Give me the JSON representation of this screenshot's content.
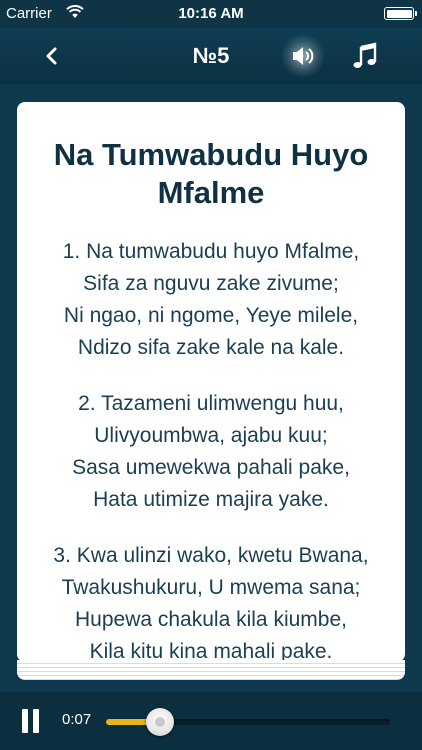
{
  "status": {
    "carrier": "Carrier",
    "time": "10:16 AM",
    "battery_level": 1.0
  },
  "nav": {
    "title": "№5",
    "back_icon": "chevron-left-icon",
    "speaker_icon": "speaker-icon",
    "music_icon": "music-note-icon"
  },
  "hymn": {
    "title": "Na Tumwabudu Huyo Mfalme",
    "verses": [
      [
        "1. Na tumwabudu huyo Mfalme,",
        "Sifa za nguvu zake zivume;",
        "Ni ngao, ni ngome, Yeye milele,",
        "Ndizo sifa zake kale na kale."
      ],
      [
        "2. Tazameni ulimwengu huu,",
        "Ulivyoumbwa, ajabu kuu;",
        "Sasa umewekwa pahali pake,",
        "Hata utimize majira yake."
      ],
      [
        "3. Kwa ulinzi wako, kwetu Bwana,",
        "Twakushukuru, U mwema sana;",
        "Hupewa chakula kila kiumbe,",
        "Kila kitu kina mahali pake."
      ]
    ]
  },
  "player": {
    "elapsed": "0:07",
    "progress": 0.19,
    "pause_icon": "pause-icon"
  },
  "colors": {
    "background": "#0f3a4e",
    "accent": "#e7b41b",
    "title_text": "#0f3143"
  }
}
